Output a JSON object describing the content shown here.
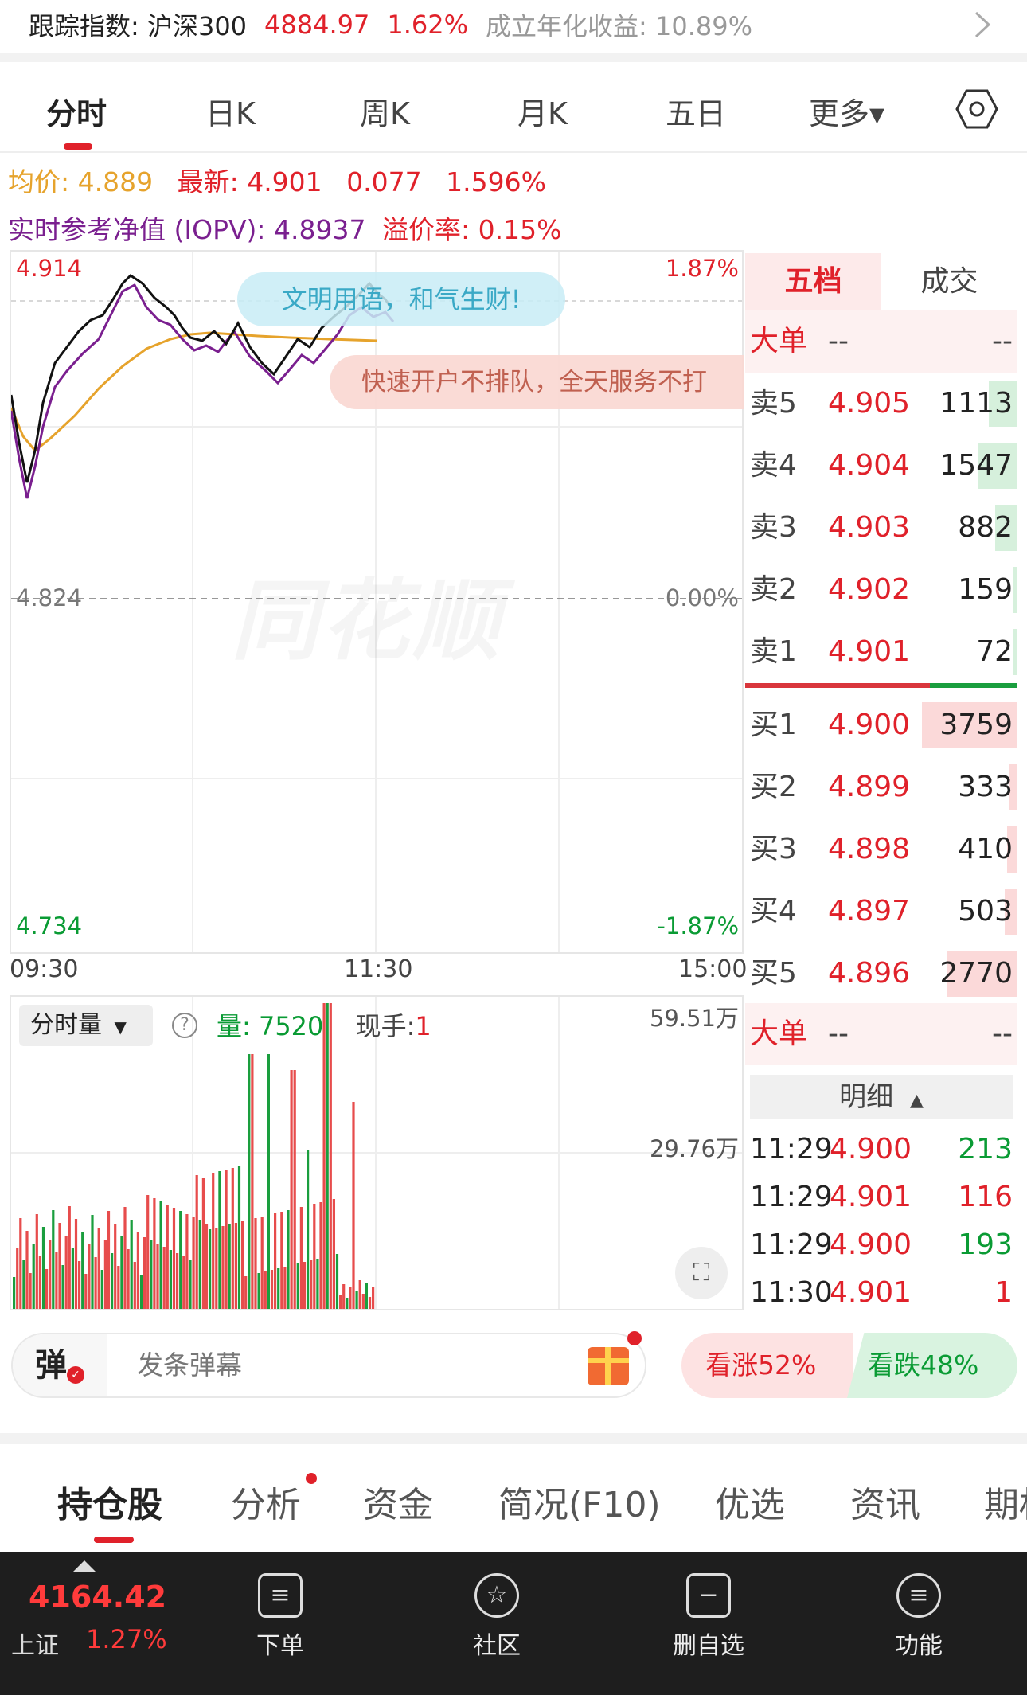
{
  "header": {
    "track_label": "跟踪指数: 沪深300",
    "index_value": "4884.97",
    "index_change": "1.62%",
    "annual_return": "成立年化收益: 10.89%"
  },
  "tabs": [
    "分时",
    "日K",
    "周K",
    "月K",
    "五日",
    "更多▾"
  ],
  "info": {
    "avg_label": "均价: 4.889",
    "latest_label": "最新: 4.901",
    "change": "0.077",
    "change_pct": "1.596%",
    "iopv": "实时参考净值 (IOPV): 4.8937",
    "premium": "溢价率: 0.15%"
  },
  "chart": {
    "y_top": "4.914",
    "y_mid": "4.824",
    "y_bottom": "4.734",
    "pct_top": "1.87%",
    "pct_mid": "0.00%",
    "pct_bottom": "-1.87%",
    "time_start": "09:30",
    "time_mid": "11:30",
    "time_end": "15:00",
    "bubble1": "文明用语，和气生财!",
    "bubble2": "快速开户不排队，全天服务不打",
    "watermark": "同花顺"
  },
  "volume": {
    "selector": "分时量",
    "help": "?",
    "vol_label": "量: 7520",
    "hand_label": "现手:",
    "hand_value": "1",
    "y_top": "59.51万",
    "y_mid": "29.76万"
  },
  "order_book": {
    "tab_active": "五档",
    "tab_other": "成交",
    "big_label": "大单",
    "big_price": "--",
    "big_vol": "--",
    "sells": [
      {
        "label": "卖5",
        "price": "4.905",
        "vol": "1113",
        "ratio": 0.3
      },
      {
        "label": "卖4",
        "price": "4.904",
        "vol": "1547",
        "ratio": 0.41
      },
      {
        "label": "卖3",
        "price": "4.903",
        "vol": "882",
        "ratio": 0.23
      },
      {
        "label": "卖2",
        "price": "4.902",
        "vol": "159",
        "ratio": 0.04
      },
      {
        "label": "卖1",
        "price": "4.901",
        "vol": "72",
        "ratio": 0.02
      }
    ],
    "buys": [
      {
        "label": "买1",
        "price": "4.900",
        "vol": "3759",
        "ratio": 1.0
      },
      {
        "label": "买2",
        "price": "4.899",
        "vol": "333",
        "ratio": 0.09
      },
      {
        "label": "买3",
        "price": "4.898",
        "vol": "410",
        "ratio": 0.11
      },
      {
        "label": "买4",
        "price": "4.897",
        "vol": "503",
        "ratio": 0.13
      },
      {
        "label": "买5",
        "price": "4.896",
        "vol": "2770",
        "ratio": 0.74
      }
    ],
    "big2_label": "大单",
    "big2_price": "--",
    "big2_vol": "--",
    "detail_title": "明细",
    "details": [
      {
        "time": "11:29",
        "price": "4.900",
        "vol": "213",
        "color": "#0a9b34"
      },
      {
        "time": "11:29",
        "price": "4.901",
        "vol": "116",
        "color": "#e0212a"
      },
      {
        "time": "11:29",
        "price": "4.900",
        "vol": "193",
        "color": "#0a9b34"
      },
      {
        "time": "11:30",
        "price": "4.901",
        "vol": "1",
        "color": "#e0212a"
      }
    ]
  },
  "danmu": {
    "button": "弹",
    "placeholder": "发条弹幕"
  },
  "vote": {
    "up": "看涨52%",
    "down": "看跌48%"
  },
  "bottom_tabs": [
    "持仓股",
    "分析",
    "资金",
    "简况(F10)",
    "优选",
    "资讯",
    "期权"
  ],
  "bottom_nav": {
    "index_value": "4164.42",
    "index_name": "上证",
    "index_change": "1.27%",
    "items": [
      "下单",
      "社区",
      "删自选",
      "功能"
    ]
  },
  "colors": {
    "up": "#e0212a",
    "down": "#0a9b34",
    "avg_line": "#e6a32c",
    "price_line": "#111111",
    "iopv_line": "#7a1f8f"
  }
}
